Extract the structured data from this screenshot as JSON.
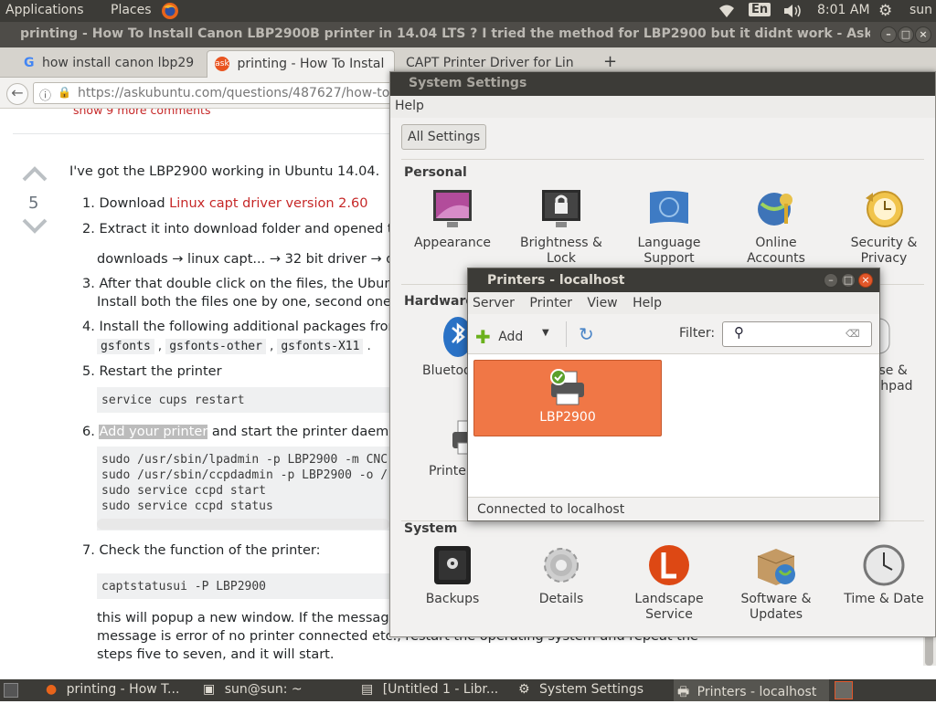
{
  "top_panel": {
    "applications": "Applications",
    "places": "Places",
    "keyboard": "En",
    "time": "8:01 AM",
    "user": "sun"
  },
  "browser": {
    "window_title": "printing - How To Install Canon LBP2900B printer in 14.04 LTS ? I tried the method for LBP2900 but it didnt work - Ask Ubuntu - Mozilla Firefox",
    "tabs": [
      {
        "label": "how install canon lbp29"
      },
      {
        "label": "printing - How To Instal"
      },
      {
        "label": "CAPT Printer Driver for Lin"
      }
    ],
    "new_tab": "+",
    "url": "https://askubuntu.com/questions/487627/how-to-"
  },
  "answer": {
    "show_more": "show 9 more comments",
    "votes": "5",
    "intro": "I've got the LBP2900 working in Ubuntu 14.04.",
    "steps": [
      {
        "num": "1.",
        "text": "Download ",
        "link": "Linux capt driver version 2.60"
      },
      {
        "num": "2.",
        "text": "Extract it into download folder and opened the"
      },
      {
        "path": "downloads → linux capt... → 32 bit driver → deb"
      },
      {
        "num": "3.",
        "text": "After that double click on the files, the Ubuntu",
        "text2": "Install both the files one by one, second one first"
      },
      {
        "num": "4.",
        "text": "Install the following additional packages from U",
        "pkgs": [
          "gsfonts",
          "gsfonts-other",
          "gsfonts-X11"
        ]
      },
      {
        "num": "5.",
        "text": "Restart the printer",
        "code": "service cups restart"
      },
      {
        "num": "6.",
        "highlight": "Add your printer",
        "text": " and start the printer daemon:",
        "code": "sudo /usr/sbin/lpadmin -p LBP2900 -m CNC\nsudo /usr/sbin/ccpdadmin -p LBP2900 -o /\nsudo service ccpd start\nsudo service ccpd status"
      },
      {
        "num": "7.",
        "text": "Check the function of the printer:",
        "code": "captstatusui -P LBP2900"
      }
    ],
    "tail1": "this will popup a new window. If the message is",
    "tail2": "message is error of no printer connected etc., restart the operating system and repeat the",
    "tail3": "steps five to seven, and it will start."
  },
  "system_settings": {
    "title": "System Settings",
    "menu_help": "Help",
    "all_settings": "All Settings",
    "personal": "Personal",
    "personal_items": [
      "Appearance",
      "Brightness & Lock",
      "Language Support",
      "Online Accounts",
      "Security & Privacy"
    ],
    "hardware": "Hardware",
    "hardware_items": [
      "Bluetooth",
      "Mouse & Touchpad",
      "Printers"
    ],
    "system": "System",
    "system_items": [
      "Backups",
      "Details",
      "Landscape Service",
      "Software & Updates",
      "Time & Date"
    ]
  },
  "printers": {
    "title": "Printers - localhost",
    "menu": [
      "Server",
      "Printer",
      "View",
      "Help"
    ],
    "add": "Add",
    "filter_label": "Filter:",
    "printer_name": "LBP2900",
    "status": "Connected to localhost"
  },
  "taskbar": [
    {
      "label": "printing - How T..."
    },
    {
      "label": "sun@sun: ~"
    },
    {
      "label": "[Untitled 1 - Libr..."
    },
    {
      "label": "System Settings"
    },
    {
      "label": "Printers - localhost"
    }
  ]
}
